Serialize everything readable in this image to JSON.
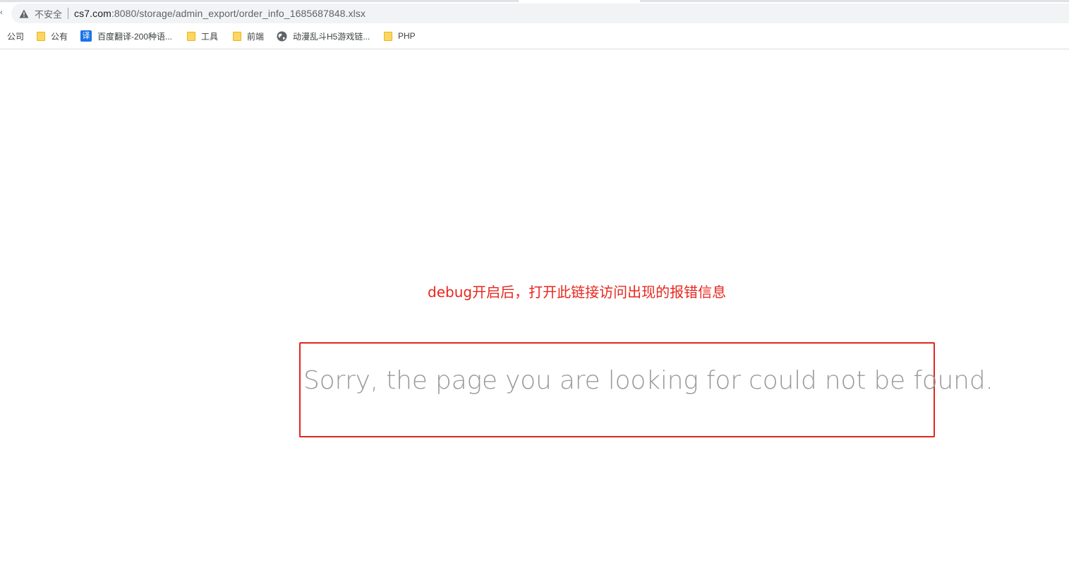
{
  "browser": {
    "security_label": "不安全",
    "url_host": "cs7.com",
    "url_rest": ":8080/storage/admin_export/order_info_1685687848.xlsx",
    "icons": {
      "security": "warning-triangle-icon",
      "folder": "folder-icon",
      "translate": "translate-icon",
      "globe": "globe-icon"
    }
  },
  "bookmarks": [
    {
      "label": "公司",
      "icon": "none"
    },
    {
      "label": "公有",
      "icon": "folder-icon"
    },
    {
      "label": "百度翻译-200种语...",
      "icon": "translate-icon",
      "icon_glyph": "译"
    },
    {
      "label": "工具",
      "icon": "folder-icon"
    },
    {
      "label": "前端",
      "icon": "folder-icon"
    },
    {
      "label": "动漫乱斗H5游戏链...",
      "icon": "globe-icon"
    },
    {
      "label": "PHP",
      "icon": "folder-icon"
    }
  ],
  "page": {
    "annotation": "debug开启后，打开此链接访问出现的报错信息",
    "error_message": "Sorry, the page you are looking for could not be found.",
    "colors": {
      "annotation": "#e8261e",
      "box_border": "#e0261d",
      "error_text": "#9a9a9a"
    }
  }
}
